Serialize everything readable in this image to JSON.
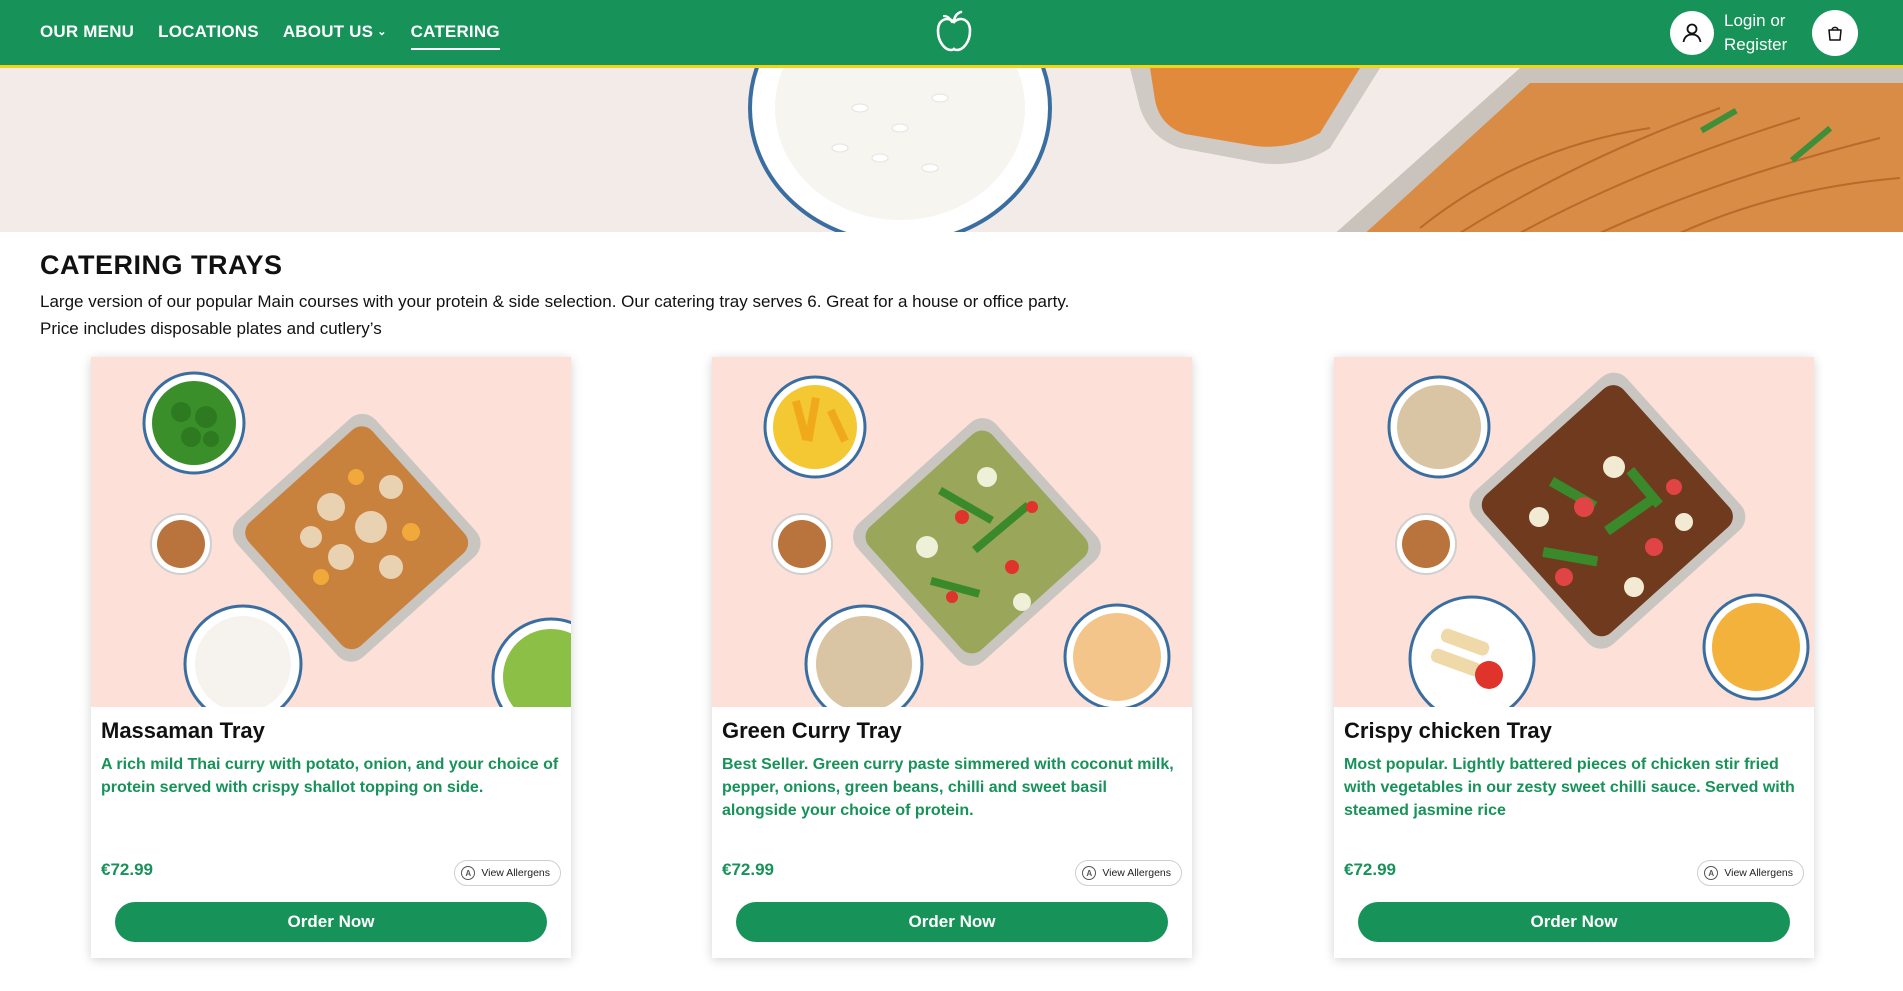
{
  "header": {
    "nav": [
      {
        "label": "OUR MENU",
        "name": "nav-our-menu",
        "active": false,
        "dropdown": false
      },
      {
        "label": "LOCATIONS",
        "name": "nav-locations",
        "active": false,
        "dropdown": false
      },
      {
        "label": "ABOUT US",
        "name": "nav-about-us",
        "active": false,
        "dropdown": true
      },
      {
        "label": "CATERING",
        "name": "nav-catering",
        "active": true,
        "dropdown": false
      }
    ],
    "logo_icon": "apple-logo-icon",
    "login_label_line1": "Login or",
    "login_label_line2": "Register",
    "user_icon": "user-icon",
    "cart_icon": "shopping-bag-icon"
  },
  "colors": {
    "brand_green": "#179259",
    "accent_yellow": "#f3d21a",
    "card_image_bg": "#fde1d8",
    "hero_bg": "#f3ebe8"
  },
  "section": {
    "title": "CATERING TRAYS",
    "description_line1": "Large version of our popular Main courses with your protein & side selection. Our catering tray serves 6. Great for a house or office party.",
    "description_line2": "Price includes disposable plates and cutlery’s"
  },
  "cards": [
    {
      "title": "Massaman Tray",
      "description": "A rich mild Thai curry with potato, onion, and your choice of protein served with crispy shallot topping on side.",
      "price": "€72.99",
      "allergens_label": "View Allergens",
      "order_label": "Order Now"
    },
    {
      "title": "Green Curry Tray",
      "description": "Best Seller. Green curry paste simmered with coconut milk, pepper, onions, green beans, chilli and sweet basil alongside your choice of protein.",
      "price": "€72.99",
      "allergens_label": "View Allergens",
      "order_label": "Order Now"
    },
    {
      "title": "Crispy chicken Tray",
      "description": "Most popular. Lightly battered pieces of chicken stir fried with vegetables in our zesty sweet chilli sauce. Served with steamed jasmine rice",
      "price": "€72.99",
      "allergens_label": "View Allergens",
      "order_label": "Order Now"
    }
  ]
}
